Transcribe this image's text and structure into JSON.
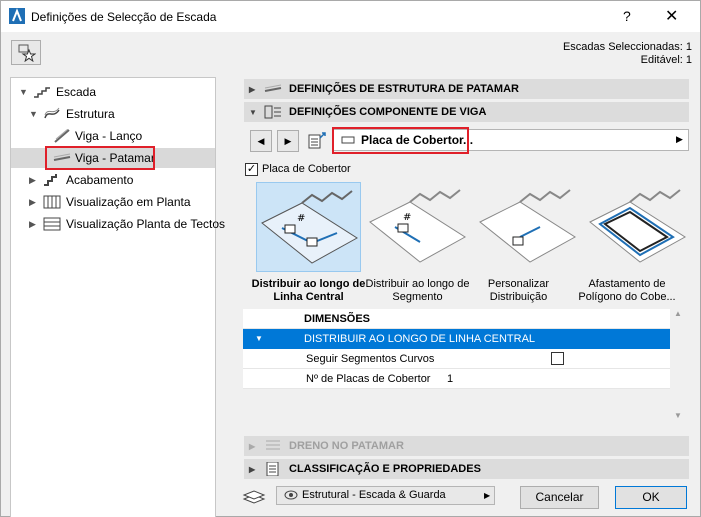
{
  "window": {
    "title": "Definições de Selecção de Escada",
    "help_label": "?",
    "close_label": "✕"
  },
  "selection_info": {
    "line1": "Escadas Seleccionadas: 1",
    "line2": "Editável: 1"
  },
  "tree": {
    "items": [
      {
        "label": "Escada"
      },
      {
        "label": "Estrutura"
      },
      {
        "label": "Viga - Lanço"
      },
      {
        "label": "Viga - Patamar"
      },
      {
        "label": "Acabamento"
      },
      {
        "label": "Visualização em Planta"
      },
      {
        "label": "Visualização Planta de Tectos"
      }
    ]
  },
  "panels": {
    "landing_structure": "DEFINIÇÕES DE ESTRUTURA DE PATAMAR",
    "beam_component": "DEFINIÇÕES COMPONENTE DE VIGA",
    "drain": "DRENO NO PATAMAR",
    "classification": "CLASSIFICAÇÃO E PROPRIEDADES"
  },
  "component_combo": {
    "value": "Placa de Cobertor..."
  },
  "cover_plate_checkbox": {
    "label": "Placa de Cobertor",
    "checked": true
  },
  "distribution_options": [
    {
      "label": "Distribuir ao longo de Linha Central",
      "selected": true
    },
    {
      "label": "Distribuir ao longo de Segmento",
      "selected": false
    },
    {
      "label": "Personalizar Distribuição",
      "selected": false
    },
    {
      "label": "Afastamento de Polígono do Cobe...",
      "selected": false
    }
  ],
  "grid": {
    "dimensions_header": "DIMENSÕES",
    "section_header": "DISTRIBUIR AO LONGO DE LINHA CENTRAL",
    "follow_curved_label": "Seguir Segmentos Curvos",
    "plates_label": "Nº de Placas de Cobertor",
    "plates_value": "1"
  },
  "footer": {
    "layer_value": "Estrutural - Escada & Guarda",
    "cancel_label": "Cancelar",
    "ok_label": "OK"
  },
  "colors": {
    "selection": "#cce4f7",
    "highlight_red": "#e0202a",
    "grid_header_blue": "#0078d7"
  }
}
